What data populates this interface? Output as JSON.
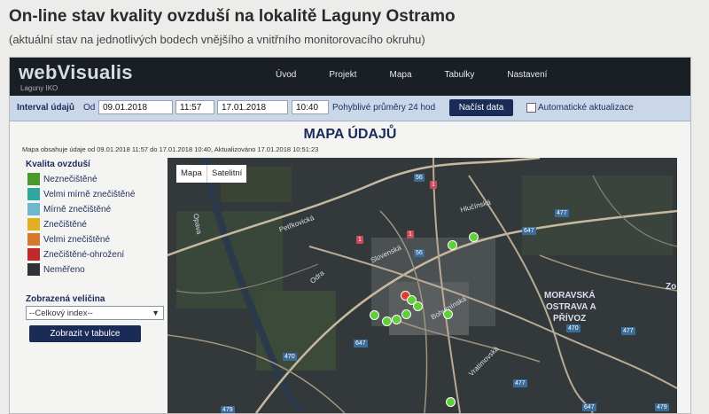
{
  "page": {
    "title": "On-line stav kvality ovzduší na lokalitě Laguny Ostramo",
    "subtitle": "(aktuální stav na jednotlivých bodech vnějšího a vnitřního monitorovacího okruhu)"
  },
  "app": {
    "logo": "webVisualis",
    "logo_sub": "Laguny IKO",
    "nav": [
      "Úvod",
      "Projekt",
      "Mapa",
      "Tabulky",
      "Nastavení"
    ]
  },
  "filter": {
    "label": "Interval údajů",
    "from_label": "Od",
    "from_date": "09.01.2018",
    "from_time": "11:57",
    "to_date": "17.01.2018",
    "to_time": "10:40",
    "rolling_label": "Pohyblivé průměry 24 hod",
    "load_button": "Načíst data",
    "auto_label": "Automatické aktualizace"
  },
  "map_section": {
    "title": "MAPA ÚDAJŮ",
    "info": "Mapa obsahuje údaje od 09.01.2018 11:57 do 17.01.2018 10:40, Aktualizováno 17.01.2018 10:51:23"
  },
  "legend": {
    "title": "Kvalita ovzduší",
    "items": [
      {
        "label": "Neznečištěné",
        "color": "#4a9a2a"
      },
      {
        "label": "Velmi mírně znečištěné",
        "color": "#2fa6a0"
      },
      {
        "label": "Mírně znečištěné",
        "color": "#6fb6cf"
      },
      {
        "label": "Znečištěné",
        "color": "#e0b020"
      },
      {
        "label": "Velmi znečištěné",
        "color": "#d9782a"
      },
      {
        "label": "Znečištěné-ohrožení",
        "color": "#c0282a"
      },
      {
        "label": "Neměřeno",
        "color": "#2f3338"
      }
    ]
  },
  "variable": {
    "label": "Zobrazená veličina",
    "selected": "--Celkový index--",
    "show_button": "Zobrazit v tabulce"
  },
  "map": {
    "type_buttons": [
      "Mapa",
      "Satelitní"
    ],
    "labels": {
      "area_line1": "MORAVSKÁ",
      "area_line2": "OSTRAVA A",
      "area_line3": "PŘÍVOZ",
      "street1": "Slovenská",
      "street2": "Petřkovická",
      "street3": "Odra",
      "street4": "Opava",
      "street5": "Hlučínská",
      "street6": "Bohumínská",
      "street7": "Vratimovská",
      "street8": "Zo"
    },
    "shields": [
      "56",
      "1",
      "1",
      "647",
      "477",
      "1",
      "56",
      "647",
      "470",
      "477",
      "470",
      "479",
      "647",
      "479",
      "477"
    ],
    "marker_color": "#5fcf3a",
    "alert_color": "#d84030"
  }
}
